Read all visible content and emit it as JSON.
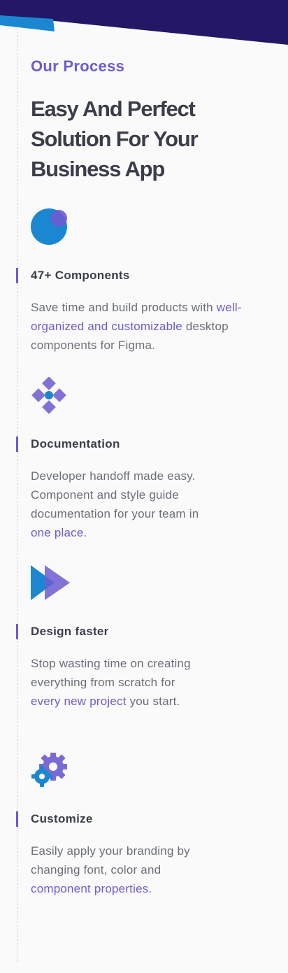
{
  "colors": {
    "navy": "#231766",
    "accent_blue": "#1b87d1",
    "accent_purple": "#6c5ccf",
    "heading": "#3b3e4a",
    "body_text": "#6b6e78"
  },
  "header": {
    "tag": "Our Process",
    "title": "Easy And Perfect Solution For Your Business App"
  },
  "features": [
    {
      "icon": "circle-overlap-icon",
      "title": "47+ Components",
      "desc_pre": "Save time and build products with ",
      "desc_highlight": "well-organized and customizable",
      "desc_post": " desktop components for Figma."
    },
    {
      "icon": "diamond-cluster-icon",
      "title": "Documentation",
      "desc_pre": "Developer handoff made easy. Component and style guide documentation for your team in ",
      "desc_highlight": "one place",
      "desc_post": "."
    },
    {
      "icon": "double-play-icon",
      "title": "Design faster",
      "desc_pre": "Stop wasting time on creating everything from scratch for ",
      "desc_highlight": "every new project",
      "desc_post": " you start."
    },
    {
      "icon": "gears-icon",
      "title": "Customize",
      "desc_pre": "Easily apply your branding by changing font, color and ",
      "desc_highlight": "component properties",
      "desc_post": "."
    }
  ]
}
